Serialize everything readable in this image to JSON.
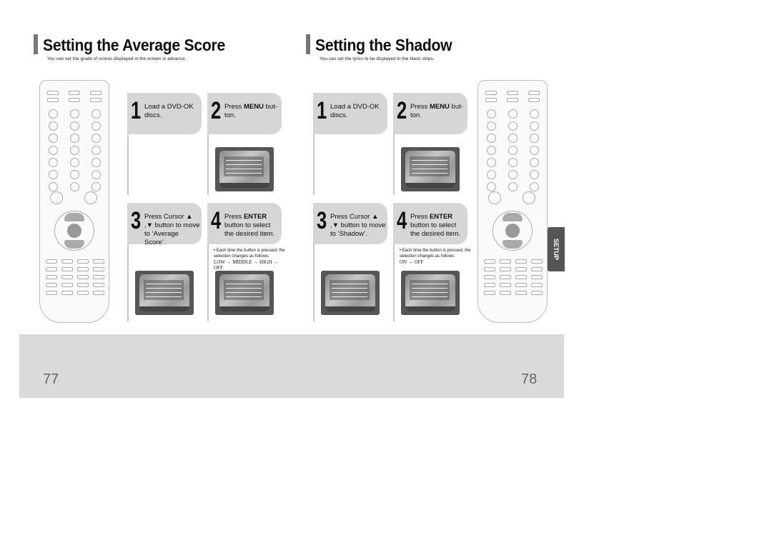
{
  "left": {
    "title": "Setting the Average Score",
    "subtitle": "You can set the grade of scores displayed in the screen in advance.",
    "steps": [
      {
        "num": "1",
        "text": "Load a DVD-OK discs."
      },
      {
        "num": "2",
        "pre": "Press ",
        "bold": "MENU",
        "post": " but-ton."
      },
      {
        "num": "3",
        "text": "Press Cursor ▲ ,▼ button to move to ‘Average Score’."
      },
      {
        "num": "4",
        "pre": "Press ",
        "bold": "ENTER",
        "post": " button to select the desired item."
      }
    ],
    "note": "• Each time the button is pressed, the selection changes as follows:",
    "sequence": "LOW → MIDDLE → HIGH → OFF",
    "page_number": "77"
  },
  "right": {
    "title": "Setting the Shadow",
    "subtitle": "You can set the lyrics to be displayed in the black strips.",
    "steps": [
      {
        "num": "1",
        "text": "Load a DVD-OK discs."
      },
      {
        "num": "2",
        "pre": "Press ",
        "bold": "MENU",
        "post": " but-ton."
      },
      {
        "num": "3",
        "text": "Press Cursor ▲ ,▼ button to move to ‘Shadow’."
      },
      {
        "num": "4",
        "pre": "Press ",
        "bold": "ENTER",
        "post": " button to select the desired item."
      }
    ],
    "note": "• Each time the button is pressed, the selection changes as follows:",
    "sequence": "ON → OFF",
    "page_number": "78"
  },
  "side_tab": "SETUP"
}
